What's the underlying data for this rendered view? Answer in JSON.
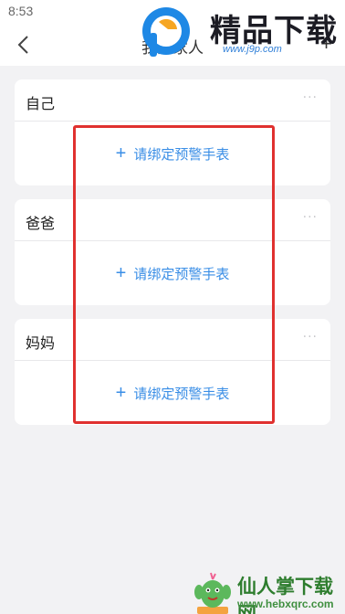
{
  "status_bar": {
    "time": "8:53"
  },
  "header": {
    "title": "我的家人",
    "back_icon": "chevron-left-icon",
    "add_label": "+"
  },
  "family": [
    {
      "name": "自己",
      "more": "···",
      "bind_plus": "+",
      "bind_label": "请绑定预警手表"
    },
    {
      "name": "爸爸",
      "more": "···",
      "bind_plus": "+",
      "bind_label": "请绑定预警手表"
    },
    {
      "name": "妈妈",
      "more": "···",
      "bind_plus": "+",
      "bind_label": "请绑定预警手表"
    }
  ],
  "watermarks": {
    "top_text": "精品下载",
    "top_url": "www.j9p.com",
    "bottom_text": "仙人掌下载网",
    "bottom_url": "www.hebxqrc.com"
  },
  "colors": {
    "accent": "#3a8ee6",
    "highlight_border": "#e0312f",
    "background": "#f2f2f4"
  }
}
